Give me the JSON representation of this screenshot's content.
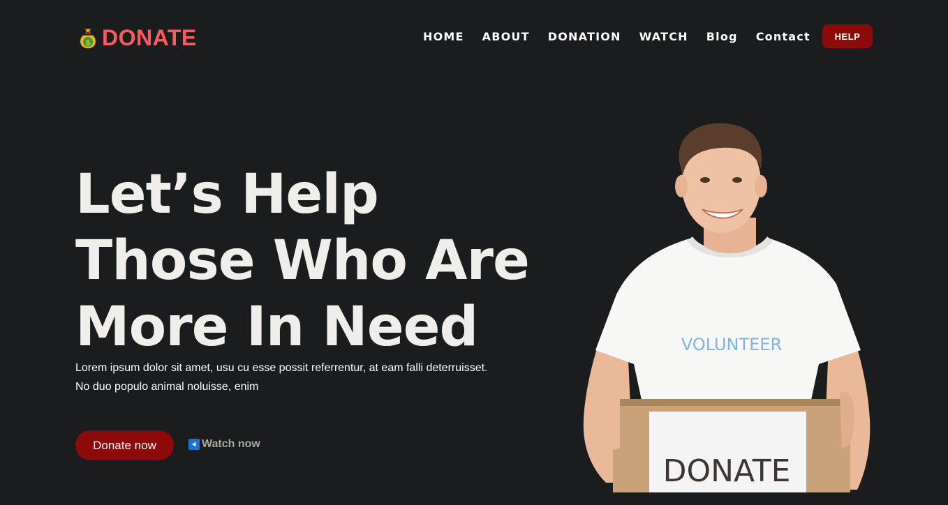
{
  "brand": {
    "name": "DONATE",
    "icon": "money-bag-icon",
    "color": "#ff5a5f"
  },
  "nav": {
    "items": [
      {
        "label": "HOME"
      },
      {
        "label": "ABOUT"
      },
      {
        "label": "DONATION"
      },
      {
        "label": "WATCH"
      },
      {
        "label": "Blog"
      },
      {
        "label": "Contact"
      }
    ],
    "help_label": "HELP"
  },
  "hero": {
    "title_lines": [
      "Let’s Help",
      "Those Who Are",
      "More In Need"
    ],
    "description_lines": [
      "Lorem ipsum dolor sit amet, usu cu esse possit referrentur, at eam falli deterruisset.",
      "No duo populo animal noluisse, enim"
    ],
    "donate_label": "Donate now",
    "watch_label": "Watch now",
    "watch_icon": "play-icon",
    "image": {
      "shirt_text": "VOLUNTEER",
      "box_text": "DONATE"
    }
  },
  "colors": {
    "background": "#1b1c1e",
    "accent": "#8e0a0a",
    "text": "#efeeea"
  }
}
